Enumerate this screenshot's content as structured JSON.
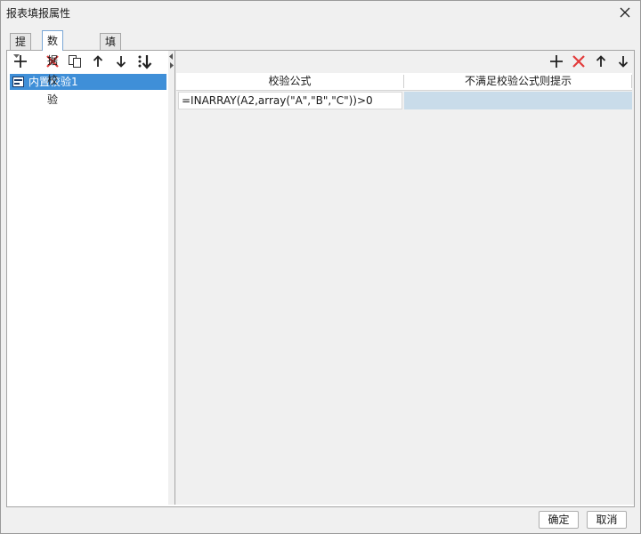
{
  "window": {
    "title": "报表填报属性",
    "close_icon": "close-icon"
  },
  "tabs": [
    {
      "label": "提交",
      "active": false
    },
    {
      "label": "数据校验",
      "active": true
    },
    {
      "label": "填报快捷键设置",
      "active": false
    }
  ],
  "left_toolbar": {
    "icons": [
      "add-icon",
      "dropdown-arrow-icon",
      "delete-icon",
      "copy-icon",
      "move-up-icon",
      "move-down-icon",
      "move-to-bottom-icon"
    ]
  },
  "validation_list": {
    "items": [
      {
        "label": "内置校验1",
        "selected": true,
        "icon": "list-item-icon"
      }
    ]
  },
  "right_toolbar": {
    "icons": [
      "add-icon",
      "delete-icon",
      "move-up-icon",
      "move-down-icon"
    ]
  },
  "grid": {
    "columns": [
      "校验公式",
      "不满足校验公式则提示"
    ],
    "rows": [
      {
        "formula": "=INARRAY(A2,array(\"A\",\"B\",\"C\"))>0",
        "message": ""
      }
    ]
  },
  "footer": {
    "ok_label": "确定",
    "cancel_label": "取消"
  },
  "colors": {
    "selection": "#3f8fd8",
    "delete_red": "#e23b3b",
    "cell_highlight": "#c9dcea"
  }
}
